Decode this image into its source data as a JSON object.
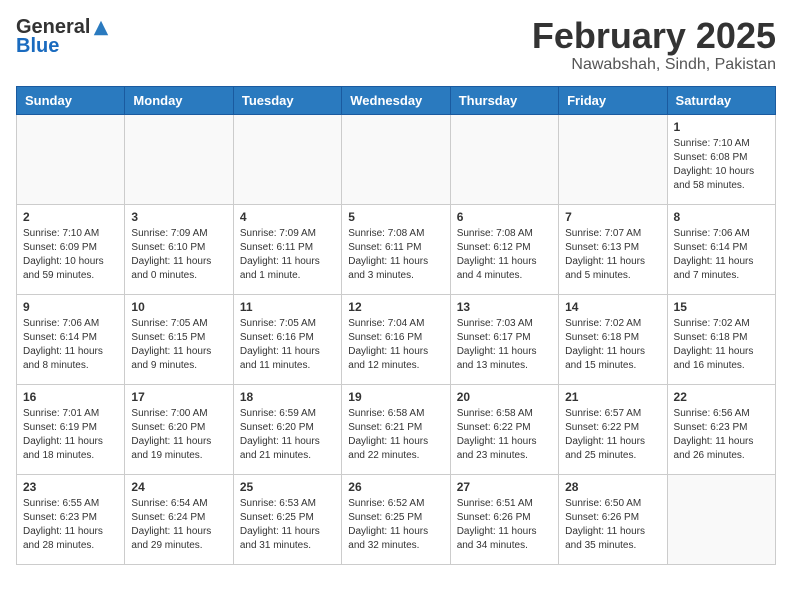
{
  "header": {
    "logo_general": "General",
    "logo_blue": "Blue",
    "main_title": "February 2025",
    "subtitle": "Nawabshah, Sindh, Pakistan"
  },
  "calendar": {
    "days_of_week": [
      "Sunday",
      "Monday",
      "Tuesday",
      "Wednesday",
      "Thursday",
      "Friday",
      "Saturday"
    ],
    "weeks": [
      [
        {
          "day": "",
          "info": ""
        },
        {
          "day": "",
          "info": ""
        },
        {
          "day": "",
          "info": ""
        },
        {
          "day": "",
          "info": ""
        },
        {
          "day": "",
          "info": ""
        },
        {
          "day": "",
          "info": ""
        },
        {
          "day": "1",
          "info": "Sunrise: 7:10 AM\nSunset: 6:08 PM\nDaylight: 10 hours and 58 minutes."
        }
      ],
      [
        {
          "day": "2",
          "info": "Sunrise: 7:10 AM\nSunset: 6:09 PM\nDaylight: 10 hours and 59 minutes."
        },
        {
          "day": "3",
          "info": "Sunrise: 7:09 AM\nSunset: 6:10 PM\nDaylight: 11 hours and 0 minutes."
        },
        {
          "day": "4",
          "info": "Sunrise: 7:09 AM\nSunset: 6:11 PM\nDaylight: 11 hours and 1 minute."
        },
        {
          "day": "5",
          "info": "Sunrise: 7:08 AM\nSunset: 6:11 PM\nDaylight: 11 hours and 3 minutes."
        },
        {
          "day": "6",
          "info": "Sunrise: 7:08 AM\nSunset: 6:12 PM\nDaylight: 11 hours and 4 minutes."
        },
        {
          "day": "7",
          "info": "Sunrise: 7:07 AM\nSunset: 6:13 PM\nDaylight: 11 hours and 5 minutes."
        },
        {
          "day": "8",
          "info": "Sunrise: 7:06 AM\nSunset: 6:14 PM\nDaylight: 11 hours and 7 minutes."
        }
      ],
      [
        {
          "day": "9",
          "info": "Sunrise: 7:06 AM\nSunset: 6:14 PM\nDaylight: 11 hours and 8 minutes."
        },
        {
          "day": "10",
          "info": "Sunrise: 7:05 AM\nSunset: 6:15 PM\nDaylight: 11 hours and 9 minutes."
        },
        {
          "day": "11",
          "info": "Sunrise: 7:05 AM\nSunset: 6:16 PM\nDaylight: 11 hours and 11 minutes."
        },
        {
          "day": "12",
          "info": "Sunrise: 7:04 AM\nSunset: 6:16 PM\nDaylight: 11 hours and 12 minutes."
        },
        {
          "day": "13",
          "info": "Sunrise: 7:03 AM\nSunset: 6:17 PM\nDaylight: 11 hours and 13 minutes."
        },
        {
          "day": "14",
          "info": "Sunrise: 7:02 AM\nSunset: 6:18 PM\nDaylight: 11 hours and 15 minutes."
        },
        {
          "day": "15",
          "info": "Sunrise: 7:02 AM\nSunset: 6:18 PM\nDaylight: 11 hours and 16 minutes."
        }
      ],
      [
        {
          "day": "16",
          "info": "Sunrise: 7:01 AM\nSunset: 6:19 PM\nDaylight: 11 hours and 18 minutes."
        },
        {
          "day": "17",
          "info": "Sunrise: 7:00 AM\nSunset: 6:20 PM\nDaylight: 11 hours and 19 minutes."
        },
        {
          "day": "18",
          "info": "Sunrise: 6:59 AM\nSunset: 6:20 PM\nDaylight: 11 hours and 21 minutes."
        },
        {
          "day": "19",
          "info": "Sunrise: 6:58 AM\nSunset: 6:21 PM\nDaylight: 11 hours and 22 minutes."
        },
        {
          "day": "20",
          "info": "Sunrise: 6:58 AM\nSunset: 6:22 PM\nDaylight: 11 hours and 23 minutes."
        },
        {
          "day": "21",
          "info": "Sunrise: 6:57 AM\nSunset: 6:22 PM\nDaylight: 11 hours and 25 minutes."
        },
        {
          "day": "22",
          "info": "Sunrise: 6:56 AM\nSunset: 6:23 PM\nDaylight: 11 hours and 26 minutes."
        }
      ],
      [
        {
          "day": "23",
          "info": "Sunrise: 6:55 AM\nSunset: 6:23 PM\nDaylight: 11 hours and 28 minutes."
        },
        {
          "day": "24",
          "info": "Sunrise: 6:54 AM\nSunset: 6:24 PM\nDaylight: 11 hours and 29 minutes."
        },
        {
          "day": "25",
          "info": "Sunrise: 6:53 AM\nSunset: 6:25 PM\nDaylight: 11 hours and 31 minutes."
        },
        {
          "day": "26",
          "info": "Sunrise: 6:52 AM\nSunset: 6:25 PM\nDaylight: 11 hours and 32 minutes."
        },
        {
          "day": "27",
          "info": "Sunrise: 6:51 AM\nSunset: 6:26 PM\nDaylight: 11 hours and 34 minutes."
        },
        {
          "day": "28",
          "info": "Sunrise: 6:50 AM\nSunset: 6:26 PM\nDaylight: 11 hours and 35 minutes."
        },
        {
          "day": "",
          "info": ""
        }
      ]
    ]
  }
}
